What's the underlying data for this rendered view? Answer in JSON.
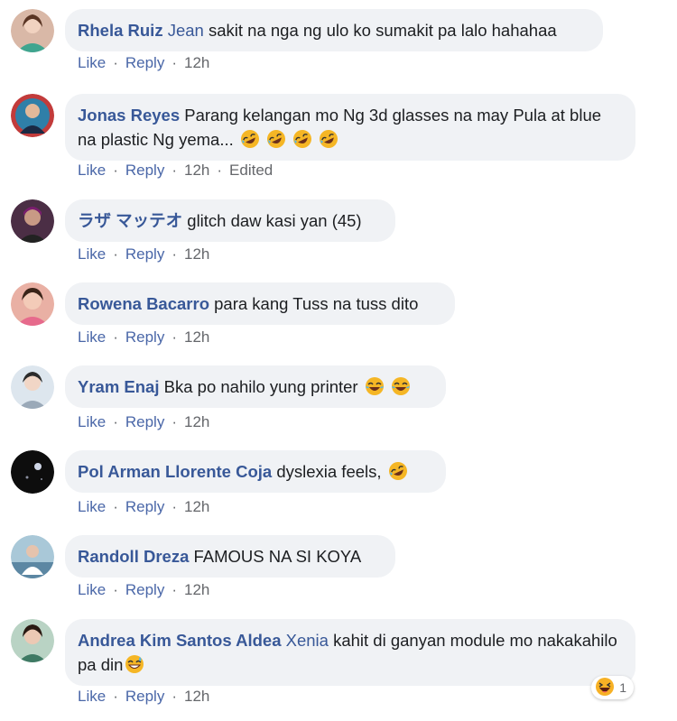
{
  "comments": [
    {
      "author": "Rhela Ruiz",
      "mention": "Jean",
      "text": "sakit na nga ng ulo ko sumakit pa lalo hahahaa",
      "actions": {
        "like": "Like",
        "reply": "Reply",
        "time": "12h"
      },
      "colors": {
        "avatar": "#c97a6a"
      }
    },
    {
      "author": "Jonas Reyes",
      "text": "Parang kelangan mo Ng 3d glasses na may Pula at blue na plastic Ng yema...",
      "emoji": "rolling-laughing",
      "emoji_count": 4,
      "actions": {
        "like": "Like",
        "reply": "Reply",
        "time": "12h",
        "edited": "Edited"
      },
      "colors": {
        "avatar": "#2f7fa8"
      }
    },
    {
      "author": "ラザ マッテオ",
      "text": "glitch daw kasi yan (45)",
      "actions": {
        "like": "Like",
        "reply": "Reply",
        "time": "12h"
      },
      "colors": {
        "avatar": "#4b2e45"
      }
    },
    {
      "author": "Rowena Bacarro",
      "text": "para kang Tuss na tuss dito",
      "actions": {
        "like": "Like",
        "reply": "Reply",
        "time": "12h"
      },
      "colors": {
        "avatar": "#e9b0a4"
      }
    },
    {
      "author": "Yram Enaj",
      "text": "Bka po nahilo yung printer",
      "emoji": "tears-of-joy",
      "emoji_count": 2,
      "actions": {
        "like": "Like",
        "reply": "Reply",
        "time": "12h"
      },
      "colors": {
        "avatar": "#b8c9d6"
      }
    },
    {
      "author": "Pol Arman Llorente Coja",
      "text": "dyslexia feels,",
      "emoji": "rolling-laughing",
      "emoji_count": 1,
      "actions": {
        "like": "Like",
        "reply": "Reply",
        "time": "12h"
      },
      "colors": {
        "avatar": "#111111"
      }
    },
    {
      "author": "Randoll Dreza",
      "text": "FAMOUS NA SI KOYA",
      "actions": {
        "like": "Like",
        "reply": "Reply",
        "time": "12h"
      },
      "colors": {
        "avatar": "#8fb3c7"
      }
    },
    {
      "author": "Andrea Kim Santos Aldea",
      "mention": "Xenia",
      "text": "kahit di ganyan module mo nakakahilo pa din",
      "emoji": "grinning-sweat",
      "emoji_count": 1,
      "actions": {
        "like": "Like",
        "reply": "Reply",
        "time": "12h"
      },
      "colors": {
        "avatar": "#5f8f7a"
      }
    }
  ],
  "reaction": {
    "icon": "haha-icon",
    "count": "1"
  },
  "colors": {
    "author": "#385898",
    "bubble": "#f0f2f5",
    "action": "#4a67a8",
    "meta": "#65676b"
  }
}
